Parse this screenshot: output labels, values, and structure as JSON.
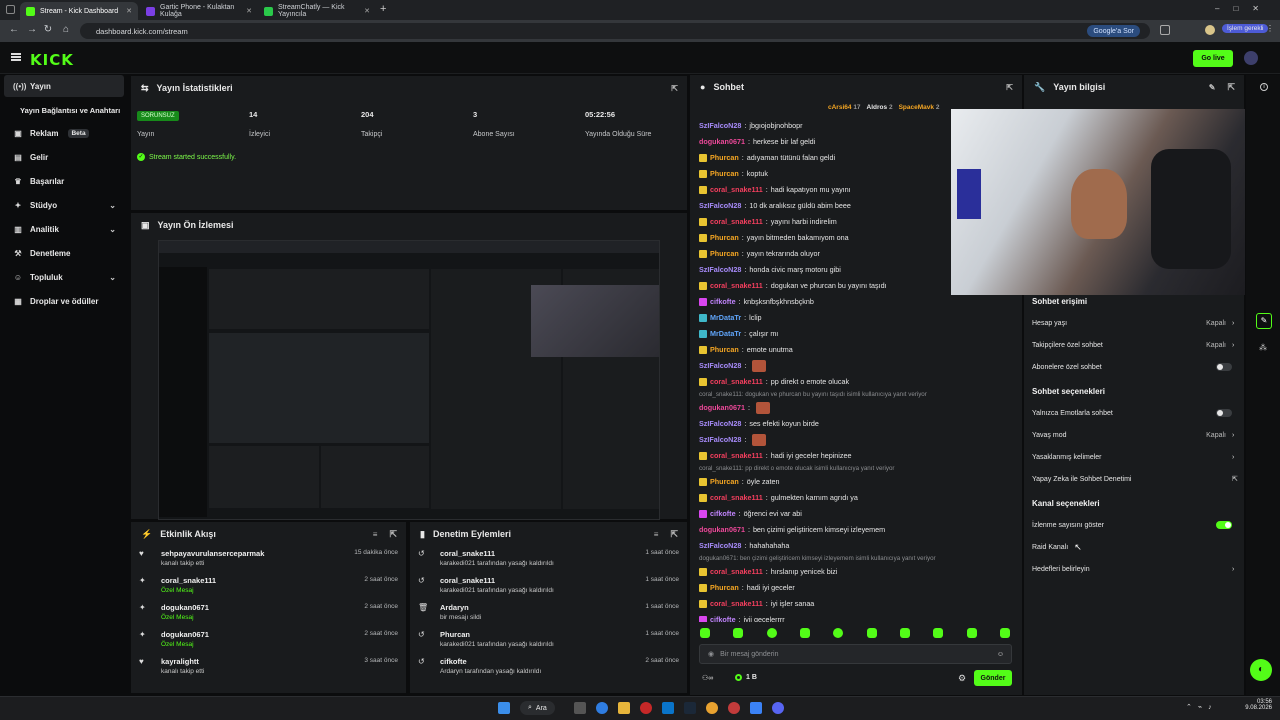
{
  "browser": {
    "tabs": [
      {
        "title": "Stream - Kick Dashboard",
        "active": true,
        "color": "#53fc18"
      },
      {
        "title": "Gartic Phone - Kulaktan Kulağa",
        "active": false,
        "color": "#7b3fe4"
      },
      {
        "title": "StreamChatly — Kick Yayıncıla",
        "active": false,
        "color": "#2ac94a"
      }
    ],
    "url": "dashboard.kick.com/stream",
    "google_button": "Google'a Sor",
    "profile_button": "İşlem gerekli"
  },
  "header": {
    "logo": "KICK",
    "go_live": "Go live"
  },
  "sidebar": {
    "items": [
      {
        "label": "Yayın",
        "icon": "broadcast-icon",
        "active": true
      },
      {
        "label": "Yayın Bağlantısı ve Anahtarı",
        "sub": true
      },
      {
        "label": "Reklam",
        "badge": "Beta",
        "icon": "ad-icon"
      },
      {
        "label": "Gelir",
        "icon": "money-icon"
      },
      {
        "label": "Başarılar",
        "icon": "trophy-icon"
      },
      {
        "label": "Stüdyo",
        "icon": "studio-icon",
        "chevron": true
      },
      {
        "label": "Analitik",
        "icon": "chart-icon",
        "chevron": true
      },
      {
        "label": "Denetleme",
        "icon": "hammer-icon"
      },
      {
        "label": "Topluluk",
        "icon": "community-icon",
        "chevron": true
      },
      {
        "label": "Droplar ve ödüller",
        "icon": "gift-icon"
      }
    ]
  },
  "stats": {
    "title": "Yayın İstatistikleri",
    "status": "SORUNSUZ",
    "status_label": "Yayın",
    "items": [
      {
        "value": "14",
        "label": "İzleyici"
      },
      {
        "value": "204",
        "label": "Takipçi"
      },
      {
        "value": "3",
        "label": "Abone Sayısı"
      },
      {
        "value": "05:22:56",
        "label": "Yayında Olduğu Süre"
      }
    ],
    "message": "Stream started successfully."
  },
  "preview": {
    "title": "Yayın Ön İzlemesi"
  },
  "activity": {
    "title": "Etkinlik Akışı",
    "rows": [
      {
        "name": "sehpayavurulanserceparmak",
        "sub": "kanalı takip etti",
        "time": "15 dakika önce",
        "sub_color": "#c9c9c9",
        "icon": "heart-icon"
      },
      {
        "name": "coral_snake111",
        "sub": "Özel Mesaj",
        "time": "2 saat önce",
        "sub_color": "#53fc18",
        "icon": "gift-icon"
      },
      {
        "name": "dogukan0671",
        "sub": "Özel Mesaj",
        "time": "2 saat önce",
        "sub_color": "#53fc18",
        "icon": "gift-icon"
      },
      {
        "name": "dogukan0671",
        "sub": "Özel Mesaj",
        "time": "2 saat önce",
        "sub_color": "#53fc18",
        "icon": "gift-icon"
      },
      {
        "name": "kayralightt",
        "sub": "kanalı takip etti",
        "time": "3 saat önce",
        "sub_color": "#c9c9c9",
        "icon": "heart-icon"
      }
    ]
  },
  "moderation": {
    "title": "Denetim Eylemleri",
    "rows": [
      {
        "name": "coral_snake111",
        "sub": "karakedi021 tarafından yasağı kaldırıldı",
        "time": "1 saat önce",
        "icon": "undo-icon"
      },
      {
        "name": "coral_snake111",
        "sub": "karakedi021 tarafından yasağı kaldırıldı",
        "time": "1 saat önce",
        "icon": "undo-icon"
      },
      {
        "name": "Ardaryn",
        "sub": "bir mesajı sildi",
        "time": "1 saat önce",
        "icon": "trash-icon"
      },
      {
        "name": "Phurcan",
        "sub": "karakedi021 tarafından yasağı kaldırıldı",
        "time": "1 saat önce",
        "icon": "undo-icon"
      },
      {
        "name": "cifkofte",
        "sub": "Ardaryn tarafından yasağı kaldırıldı",
        "time": "2 saat önce",
        "icon": "undo-icon"
      }
    ]
  },
  "chat": {
    "title": "Sohbet",
    "top_gifters": [
      {
        "name": "cArsi64",
        "count": "17"
      },
      {
        "name": "Aldros",
        "count": "2"
      },
      {
        "name": "SpaceMavk",
        "count": "2"
      }
    ],
    "messages": [
      {
        "user": "SzIFalcoN28",
        "color": "#a78bfa",
        "text": "jbgıojobjnohbopr"
      },
      {
        "user": "dogukan0671",
        "color": "#ec4899",
        "text": "herkese bir laf geldi"
      },
      {
        "user": "Phurcan",
        "color": "#f5a623",
        "text": "adıyaman tütünü falan geldi",
        "badge": "#e8c431"
      },
      {
        "user": "Phurcan",
        "color": "#f5a623",
        "text": "koptuk",
        "badge": "#e8c431"
      },
      {
        "user": "coral_snake111",
        "color": "#f43f5e",
        "text": "hadi kapatıyon mu yayını",
        "badge": "#e8c431"
      },
      {
        "user": "SzIFalcoN28",
        "color": "#a78bfa",
        "text": "10 dk aralıksız güldü abim beee"
      },
      {
        "user": "coral_snake111",
        "color": "#f43f5e",
        "text": "yayını harbi indirelim",
        "badge": "#e8c431"
      },
      {
        "user": "Phurcan",
        "color": "#f5a623",
        "text": "yayın bitmeden bakamıyom ona",
        "badge": "#e8c431"
      },
      {
        "user": "Phurcan",
        "color": "#f5a623",
        "text": "yayın tekrarında oluyor",
        "badge": "#e8c431"
      },
      {
        "user": "SzIFalcoN28",
        "color": "#a78bfa",
        "text": "honda civic marş motoru gibi"
      },
      {
        "user": "coral_snake111",
        "color": "#f43f5e",
        "text": "dogukan ve phurcan bu yayını taşıdı",
        "badge": "#e8c431"
      },
      {
        "user": "cifkofte",
        "color": "#c084fc",
        "text": "knbşksnfbşkhnsbçknb",
        "badge": "#d946ef"
      },
      {
        "user": "MrDataTr",
        "color": "#60a5fa",
        "text": "lclip",
        "badge": "#3fb8c9"
      },
      {
        "user": "MrDataTr",
        "color": "#60a5fa",
        "text": "çalışır mı",
        "badge": "#3fb8c9"
      },
      {
        "user": "Phurcan",
        "color": "#f5a623",
        "text": "emote unutma",
        "badge": "#e8c431"
      },
      {
        "user": "SzIFalcoN28",
        "color": "#a78bfa",
        "text": ""
      },
      {
        "user": "coral_snake111",
        "color": "#f43f5e",
        "text": "pp direkt o emote olucak",
        "badge": "#e8c431"
      },
      {
        "reply": "coral_snake111: dogukan ve phurcan bu yayını taşıdı isimli kullanıcıya yanıt veriyor"
      },
      {
        "user": "dogukan0671",
        "color": "#ec4899",
        "text": ""
      },
      {
        "user": "SzIFalcoN28",
        "color": "#a78bfa",
        "text": "ses efekti koyun birde"
      },
      {
        "user": "SzIFalcoN28",
        "color": "#a78bfa",
        "text": ""
      },
      {
        "user": "coral_snake111",
        "color": "#f43f5e",
        "text": "hadi iyi geceler hepinizee",
        "badge": "#e8c431"
      },
      {
        "reply": "coral_snake111: pp direkt o emote olucak isimli kullanıcıya yanıt veriyor"
      },
      {
        "user": "Phurcan",
        "color": "#f5a623",
        "text": "öyle zaten",
        "badge": "#e8c431"
      },
      {
        "user": "coral_snake111",
        "color": "#f43f5e",
        "text": "gulmekten karnım agrıdı ya",
        "badge": "#e8c431"
      },
      {
        "user": "cifkofte",
        "color": "#c084fc",
        "text": "öğrenci evi var abi",
        "badge": "#d946ef"
      },
      {
        "user": "dogukan0671",
        "color": "#ec4899",
        "text": "ben çizimi geliştiricem kimseyi izleyemem"
      },
      {
        "user": "SzIFalcoN28",
        "color": "#a78bfa",
        "text": "hahahahaha"
      },
      {
        "reply": "dogukan0671: ben çizimi geliştiricem kimseyi izleyemem isimli kullanıcıya yanıt veriyor"
      },
      {
        "user": "coral_snake111",
        "color": "#f43f5e",
        "text": "hırslanıp yenicek bizi",
        "badge": "#e8c431"
      },
      {
        "user": "Phurcan",
        "color": "#f5a623",
        "text": "hadi iyi geceler",
        "badge": "#e8c431"
      },
      {
        "user": "coral_snake111",
        "color": "#f43f5e",
        "text": "iyi işler sanaa",
        "badge": "#e8c431"
      },
      {
        "user": "cifkofte",
        "color": "#c084fc",
        "text": "iyii gecelerrrr",
        "badge": "#d946ef"
      }
    ],
    "placeholder": "Bir mesaj gönderin",
    "points": "1 B",
    "send": "Gönder"
  },
  "settings": {
    "title": "Yayın bilgisi",
    "section_chat_access": "Sohbet erişimi",
    "rows1": [
      {
        "label": "Hesap yaşı",
        "value": "Kapalı",
        "type": "chev"
      },
      {
        "label": "Takipçilere özel sohbet",
        "value": "Kapalı",
        "type": "chev"
      },
      {
        "label": "Abonelere özel sohbet",
        "type": "toggle",
        "on": false
      }
    ],
    "section_chat_options": "Sohbet seçenekleri",
    "rows2": [
      {
        "label": "Yalnızca Emotlarla sohbet",
        "type": "toggle",
        "on": false
      },
      {
        "label": "Yavaş mod",
        "value": "Kapalı",
        "type": "chev"
      },
      {
        "label": "Yasaklanmış kelimeler",
        "type": "chev"
      },
      {
        "label": "Yapay Zeka ile Sohbet Denetimi",
        "type": "ext"
      }
    ],
    "section_channel": "Kanal seçenekleri",
    "rows3": [
      {
        "label": "İzlenme sayısını göster",
        "type": "toggle",
        "on": true
      },
      {
        "label": "Raid Kanalı",
        "type": "none"
      },
      {
        "label": "Hedefleri belirleyin",
        "type": "chev"
      }
    ]
  },
  "taskbar": {
    "search": "Ara",
    "time": "03:56",
    "date": "9.08.2026"
  }
}
